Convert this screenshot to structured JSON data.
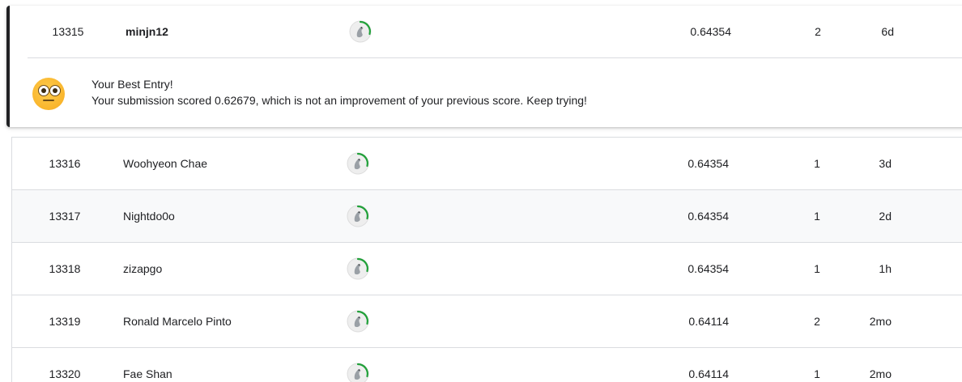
{
  "my_entry": {
    "rank": "13315",
    "name": "minjn12",
    "score": "0.64354",
    "entries": "2",
    "last": "6d",
    "avatar_icon": "goose-avatar-icon",
    "best_entry": {
      "emoji_icon": "wide-eyed-emoji-icon",
      "title": "Your Best Entry!",
      "message": "Your submission scored 0.62679, which is not an improvement of your previous score. Keep trying!"
    }
  },
  "rows": [
    {
      "rank": "13316",
      "name": "Woohyeon Chae",
      "score": "0.64354",
      "entries": "1",
      "last": "3d"
    },
    {
      "rank": "13317",
      "name": "Nightdo0o",
      "score": "0.64354",
      "entries": "1",
      "last": "2d"
    },
    {
      "rank": "13318",
      "name": "zizapgo",
      "score": "0.64354",
      "entries": "1",
      "last": "1h"
    },
    {
      "rank": "13319",
      "name": "Ronald Marcelo Pinto",
      "score": "0.64114",
      "entries": "2",
      "last": "2mo"
    },
    {
      "rank": "13320",
      "name": "Fae Shan",
      "score": "0.64114",
      "entries": "1",
      "last": "2mo"
    }
  ],
  "colors": {
    "progress_ring": "#20a139",
    "divider": "#dadce0",
    "alt_row": "#f8f9fa",
    "text": "#202124"
  }
}
